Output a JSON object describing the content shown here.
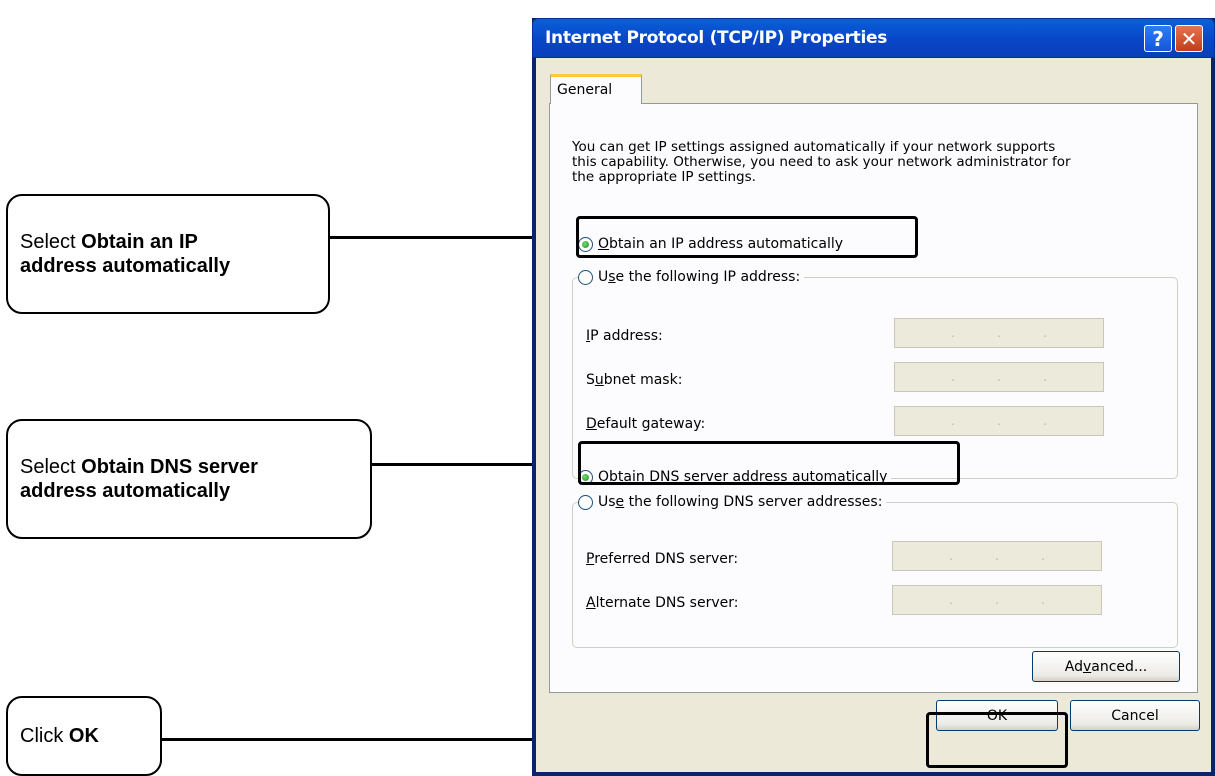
{
  "callouts": {
    "ip": {
      "prefix": "Select ",
      "bold": "Obtain an IP",
      "bold2": "address automatically"
    },
    "dns": {
      "prefix": "Select ",
      "bold": "Obtain DNS server",
      "bold2": "address automatically"
    },
    "ok": {
      "prefix": "Click ",
      "bold": "OK"
    }
  },
  "dialog": {
    "title": "Internet Protocol (TCP/IP) Properties",
    "help_glyph": "?",
    "close_glyph": "✕",
    "tab": "General",
    "description": [
      "You can get IP settings assigned automatically if your network supports",
      "this capability. Otherwise, you need to ask your network administrator for",
      "the appropriate IP settings."
    ],
    "ip_auto": {
      "key": "O",
      "rest": "btain an IP address automatically",
      "selected": true
    },
    "ip_manual": {
      "pre": "U",
      "key": "s",
      "rest": "e the following IP address:",
      "selected": false
    },
    "ip_fields": {
      "ip_address": {
        "key": "I",
        "rest": "P address:"
      },
      "subnet": {
        "pre": "S",
        "key": "u",
        "rest": "bnet mask:"
      },
      "gateway": {
        "key": "D",
        "rest": "efault gateway:"
      }
    },
    "dns_auto": {
      "pre": "O",
      "key": "b",
      "rest": "tain DNS server address automatically",
      "selected": true
    },
    "dns_manual": {
      "pre": "Us",
      "key": "e",
      "rest": " the following DNS server addresses:",
      "selected": false
    },
    "dns_fields": {
      "preferred": {
        "key": "P",
        "rest": "referred DNS server:"
      },
      "alternate": {
        "key": "A",
        "rest": "lternate DNS server:"
      }
    },
    "ip_dots": ".",
    "advanced": {
      "pre": "Ad",
      "key": "v",
      "rest": "anced..."
    },
    "ok": "OK",
    "cancel": "Cancel"
  }
}
